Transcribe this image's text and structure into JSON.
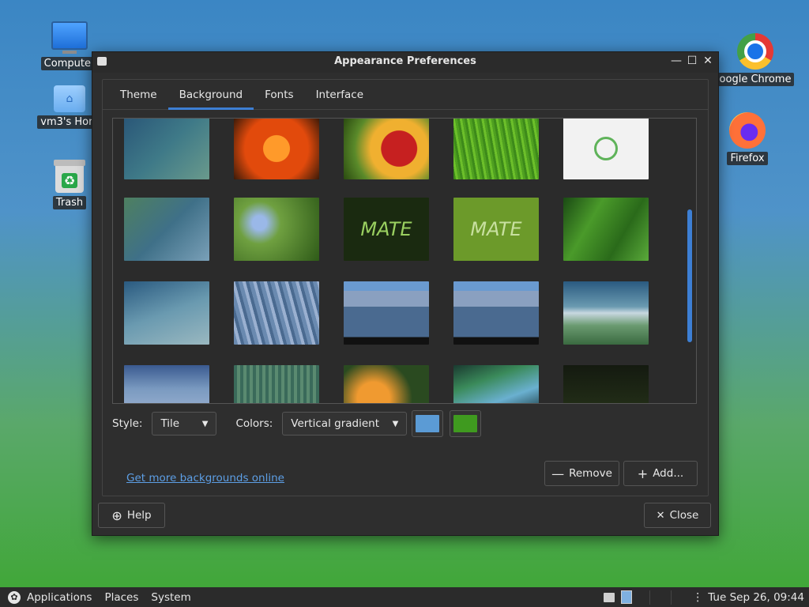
{
  "desktop": {
    "icons": [
      {
        "label": "Computer"
      },
      {
        "label": "vm3's Hom"
      },
      {
        "label": "Trash"
      },
      {
        "label": "oogle Chrome"
      },
      {
        "label": "Firefox"
      }
    ]
  },
  "window": {
    "title": "Appearance Preferences",
    "controls": {
      "minimize": "—",
      "maximize": "☐",
      "close": "✕"
    },
    "tabs": [
      {
        "label": "Theme",
        "active": false
      },
      {
        "label": "Background",
        "active": true
      },
      {
        "label": "Fonts",
        "active": false
      },
      {
        "label": "Interface",
        "active": false
      }
    ],
    "thumbnails": {
      "mate_logo_text": "MATE"
    },
    "style_label": "Style:",
    "style_value": "Tile",
    "colors_label": "Colors:",
    "colors_value": "Vertical gradient",
    "color1": "#5b9bd5",
    "color2": "#3f9a1f",
    "get_more_link": "Get more backgrounds online",
    "remove_label": "Remove",
    "add_label": "Add...",
    "help_label": "Help",
    "close_label": "Close"
  },
  "taskbar": {
    "applications": "Applications",
    "places": "Places",
    "system": "System",
    "clock": "Tue Sep 26, 09:44"
  },
  "colors": {
    "accent": "#3d7fd4",
    "link": "#5d9fe6",
    "window_bg": "#2e2e2e"
  }
}
